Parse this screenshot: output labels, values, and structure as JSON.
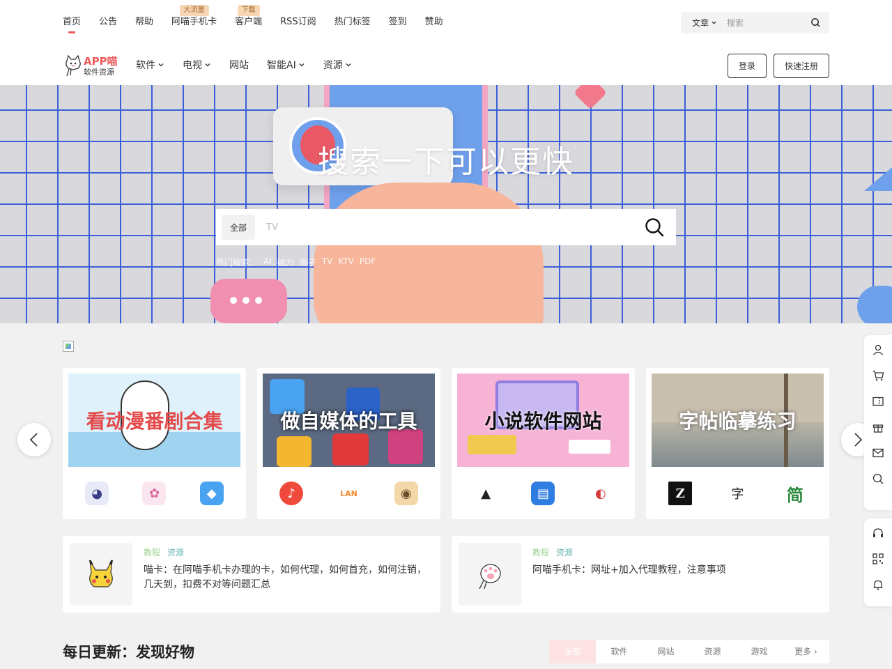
{
  "topnav": {
    "items": [
      {
        "label": "首页",
        "badge": ""
      },
      {
        "label": "公告",
        "badge": ""
      },
      {
        "label": "帮助",
        "badge": ""
      },
      {
        "label": "阿喵手机卡",
        "badge": "大流量"
      },
      {
        "label": "客户端",
        "badge": "下载"
      },
      {
        "label": "RSS订阅",
        "badge": ""
      },
      {
        "label": "热门标签",
        "badge": ""
      },
      {
        "label": "签到",
        "badge": ""
      },
      {
        "label": "赞助",
        "badge": ""
      }
    ],
    "search": {
      "type_label": "文章",
      "placeholder": "搜索"
    }
  },
  "header": {
    "logo_title": "APP喵",
    "logo_sub": "软件资源",
    "nav": [
      "软件",
      "电视",
      "网站",
      "智能AI",
      "资源"
    ],
    "nav_has_dropdown": [
      true,
      true,
      false,
      true,
      true
    ],
    "login_label": "登录",
    "register_label": "快速注册"
  },
  "hero": {
    "title": "搜索一下可以更快",
    "category_label": "全部",
    "placeholder": "TV",
    "hot_label": "热门搜索：",
    "hot_tags": [
      "AI",
      "磁力",
      "圈子",
      "TV",
      "KTV",
      "PDF"
    ]
  },
  "cards": [
    {
      "banner_text": "看动漫番剧合集",
      "banner_bg": "#dff1fb",
      "banner_color": "#e34b4b",
      "icons": [
        {
          "glyph": "◕",
          "bg": "#e8ebf7",
          "color": "#3a3f86"
        },
        {
          "glyph": "✿",
          "bg": "#fbe6f0",
          "color": "#d96a9c"
        },
        {
          "glyph": "◆",
          "bg": "#4aa3f0",
          "color": "#ffffff"
        }
      ]
    },
    {
      "banner_text": "做自媒体的工具",
      "banner_bg": "#5b6a82",
      "banner_color": "#ffffff",
      "icons": [
        {
          "glyph": "♪",
          "bg": "#ef4a3c",
          "color": "#ffffff"
        },
        {
          "glyph": "LAN",
          "bg": "#ffffff",
          "color": "#f28a2e"
        },
        {
          "glyph": "◉",
          "bg": "#f3d7a8",
          "color": "#6a4b2a"
        }
      ]
    },
    {
      "banner_text": "小说软件网站",
      "banner_bg": "#f6b3d6",
      "banner_color": "#111111",
      "icons": [
        {
          "glyph": "▲",
          "bg": "#ffffff",
          "color": "#222222"
        },
        {
          "glyph": "▤",
          "bg": "#2f7de1",
          "color": "#ffffff"
        },
        {
          "glyph": "◐",
          "bg": "#ffffff",
          "color": "#d43b3b"
        }
      ]
    },
    {
      "banner_text": "字帖临摹练习",
      "banner_bg": "#c9bfae",
      "banner_color": "#ffffff",
      "icons": [
        {
          "glyph": "Z",
          "bg": "#111111",
          "color": "#ffffff"
        },
        {
          "glyph": "字",
          "bg": "#ffffff",
          "color": "#222222"
        },
        {
          "glyph": "简",
          "bg": "#ffffff",
          "color": "#2f8a3e"
        }
      ]
    }
  ],
  "articles": [
    {
      "tag1": "教程",
      "tag2": "资源",
      "title": "喵卡：在阿喵手机卡办理的卡，如何代理，如何首充，如何注销，几天到，扣费不对等问题汇总"
    },
    {
      "tag1": "教程",
      "tag2": "资源",
      "title": "阿喵手机卡：网址+加入代理教程，注意事项"
    }
  ],
  "section": {
    "title": "每日更新：发现好物",
    "tabs": [
      "全部",
      "软件",
      "网站",
      "资源",
      "游戏",
      "更多"
    ]
  },
  "floatbar": {
    "group1": [
      "user-icon",
      "cart-icon",
      "ticket-icon",
      "gift-icon",
      "mail-icon",
      "search-icon"
    ],
    "group2": [
      "headset-icon",
      "qrcode-icon",
      "bell-icon"
    ]
  },
  "colors": {
    "accent": "#f05a5a",
    "hero_grid": "#3b5fd8",
    "badge_bg": "#f6d6b4"
  }
}
